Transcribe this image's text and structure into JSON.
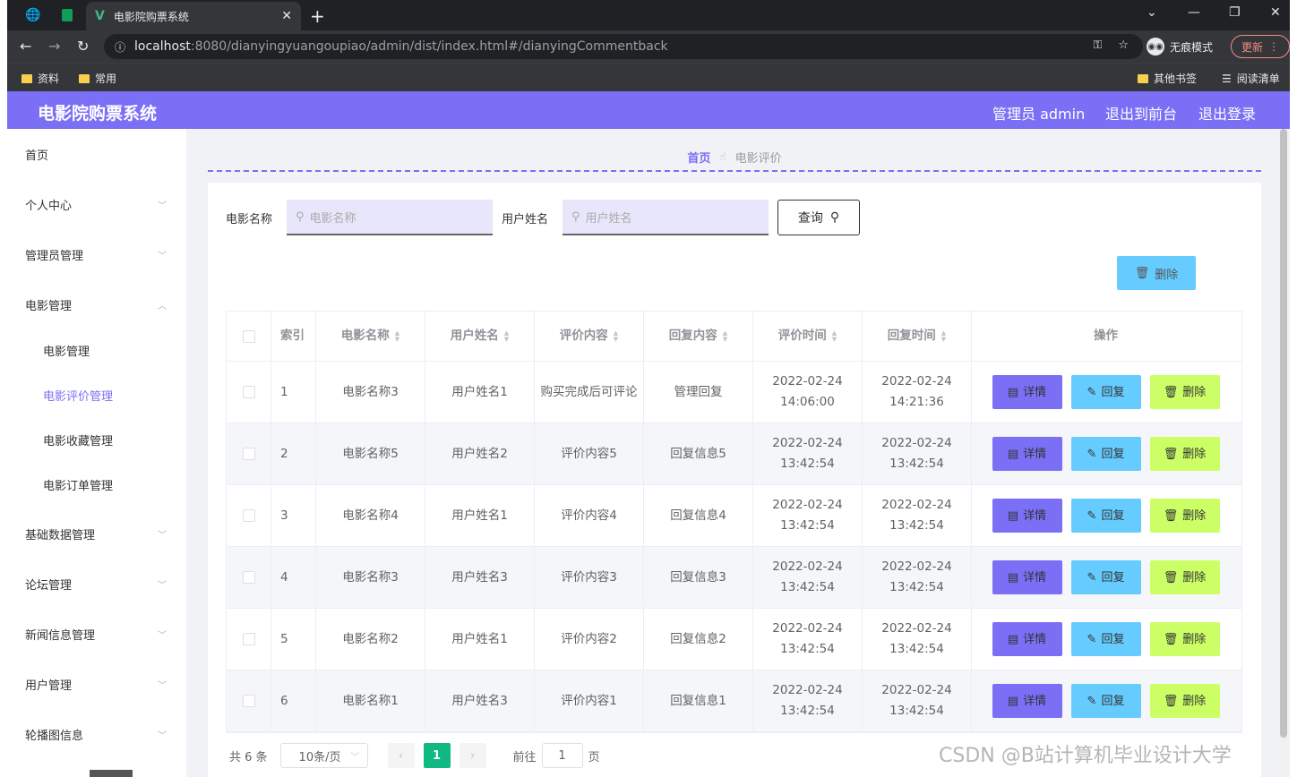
{
  "browser": {
    "tab_title": "电影院购票系统",
    "url_host": "localhost",
    "url_rest": ":8080/dianyingyuangoupiao/admin/dist/index.html#/dianyingCommentback",
    "incognito_label": "无痕模式",
    "update_label": "更新",
    "bookmarks": [
      "资料",
      "常用"
    ],
    "other_bookmarks": "其他书签",
    "reading_list": "阅读清单"
  },
  "header": {
    "title": "电影院购票系统",
    "admin": "管理员 admin",
    "to_front": "退出到前台",
    "logout": "退出登录"
  },
  "sidebar": {
    "items": [
      "首页",
      "个人中心",
      "管理员管理",
      "电影管理",
      "基础数据管理",
      "论坛管理",
      "新闻信息管理",
      "用户管理",
      "轮播图信息"
    ],
    "sub_items": [
      "电影管理",
      "电影评价管理",
      "电影收藏管理",
      "电影订单管理"
    ],
    "active_sub": "电影评价管理"
  },
  "breadcrumb": {
    "home": "首页",
    "current": "电影评价"
  },
  "search": {
    "movie_label": "电影名称",
    "movie_placeholder": "电影名称",
    "user_label": "用户姓名",
    "user_placeholder": "用户姓名",
    "query_label": "查询"
  },
  "batch_delete_label": "删除",
  "table": {
    "headers": [
      "索引",
      "电影名称",
      "用户姓名",
      "评价内容",
      "回复内容",
      "评价时间",
      "回复时间",
      "操作"
    ],
    "rows": [
      {
        "index": "1",
        "movie": "电影名称3",
        "user": "用户姓名1",
        "comment": "购买完成后可评论",
        "reply": "管理回复",
        "comment_time": "2022-02-24 14:06:00",
        "reply_time": "2022-02-24 14:21:36"
      },
      {
        "index": "2",
        "movie": "电影名称5",
        "user": "用户姓名2",
        "comment": "评价内容5",
        "reply": "回复信息5",
        "comment_time": "2022-02-24 13:42:54",
        "reply_time": "2022-02-24 13:42:54"
      },
      {
        "index": "3",
        "movie": "电影名称4",
        "user": "用户姓名1",
        "comment": "评价内容4",
        "reply": "回复信息4",
        "comment_time": "2022-02-24 13:42:54",
        "reply_time": "2022-02-24 13:42:54"
      },
      {
        "index": "4",
        "movie": "电影名称3",
        "user": "用户姓名3",
        "comment": "评价内容3",
        "reply": "回复信息3",
        "comment_time": "2022-02-24 13:42:54",
        "reply_time": "2022-02-24 13:42:54"
      },
      {
        "index": "5",
        "movie": "电影名称2",
        "user": "用户姓名1",
        "comment": "评价内容2",
        "reply": "回复信息2",
        "comment_time": "2022-02-24 13:42:54",
        "reply_time": "2022-02-24 13:42:54"
      },
      {
        "index": "6",
        "movie": "电影名称1",
        "user": "用户姓名3",
        "comment": "评价内容1",
        "reply": "回复信息1",
        "comment_time": "2022-02-24 13:42:54",
        "reply_time": "2022-02-24 13:42:54"
      }
    ],
    "actions": {
      "detail": "详情",
      "reply": "回复",
      "delete": "删除"
    }
  },
  "pagination": {
    "total": "共 6 条",
    "page_size": "10条/页",
    "current_page": "1",
    "goto_label": "前往",
    "goto_value": "1",
    "page_suffix": "页"
  },
  "watermark": "CSDN @B站计算机毕业设计大学",
  "colors": {
    "accent": "#7b6ff6",
    "reply_btn": "#66ccff",
    "delete_btn": "#ccff66",
    "page_active": "#10b981"
  }
}
